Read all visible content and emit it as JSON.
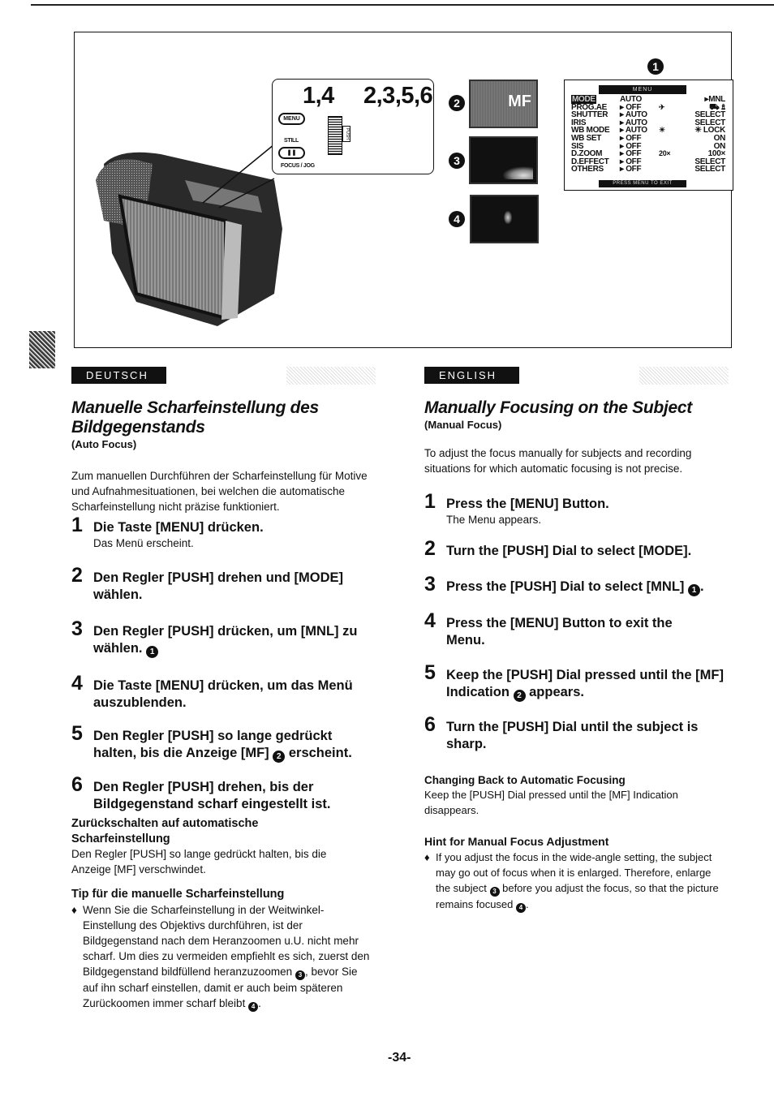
{
  "figure": {
    "callout": {
      "group_a": "1,4",
      "group_b": "2,3,5,6",
      "menu_button": "MENU",
      "still_label": "STILL",
      "still_button": "❚❚",
      "focus_jog_label": "FOCUS / JOG",
      "push_label": "PUSH"
    },
    "badges": [
      "1",
      "2",
      "3",
      "4"
    ],
    "screen_2_indicator": "MF",
    "menu_display": {
      "header": "MENU",
      "rows": [
        {
          "item": "MODE",
          "current": "AUTO",
          "extra": "",
          "option": "▸MNL",
          "highlight": true
        },
        {
          "item": "PROG.AE",
          "current": "▸ OFF",
          "extra": "✈",
          "option": "⛟ ♙",
          "highlight": false
        },
        {
          "item": "SHUTTER",
          "current": "▸ AUTO",
          "extra": "",
          "option": "SELECT",
          "highlight": false
        },
        {
          "item": "IRIS",
          "current": "▸ AUTO",
          "extra": "",
          "option": "SELECT",
          "highlight": false
        },
        {
          "item": "WB MODE",
          "current": "▸ AUTO",
          "extra": "☀",
          "option": "✳ LOCK",
          "highlight": false
        },
        {
          "item": "WB SET",
          "current": "▸ OFF",
          "extra": "",
          "option": "ON",
          "highlight": false
        },
        {
          "item": "SIS",
          "current": "▸ OFF",
          "extra": "",
          "option": "ON",
          "highlight": false
        },
        {
          "item": "D.ZOOM",
          "current": "▸ OFF",
          "extra": "20×",
          "option": "100×",
          "highlight": false
        },
        {
          "item": "D.EFFECT",
          "current": "▸ OFF",
          "extra": "",
          "option": "SELECT",
          "highlight": false
        },
        {
          "item": "OTHERS",
          "current": "▸ OFF",
          "extra": "",
          "option": "SELECT",
          "highlight": false
        }
      ],
      "footer": "PRESS MENU TO EXIT"
    }
  },
  "deutsch": {
    "lang_tab": "DEUTSCH",
    "title": "Manuelle Scharfeinstellung des Bildgegenstands",
    "subtitle": "(Auto Focus)",
    "intro": "Zum manuellen Durchführen der Scharfeinstellung für Motive und Aufnahmesituationen, bei welchen die automatische Scharfeinstellung nicht präzise funktioniert.",
    "steps": [
      {
        "num": "1",
        "text": "Die Taste [MENU] drücken.",
        "note": "Das Menü erscheint."
      },
      {
        "num": "2",
        "text": "Den Regler [PUSH] drehen und [MODE] wählen."
      },
      {
        "num": "3",
        "text": "Den Regler [PUSH] drücken, um [MNL] zu wählen.",
        "badge": "1"
      },
      {
        "num": "4",
        "text": "Die Taste [MENU] drücken, um das Menü auszublenden."
      },
      {
        "num": "5",
        "text": "Den Regler [PUSH] so lange gedrückt halten, bis die Anzeige [MF]",
        "badge": "2",
        "tail": "erscheint."
      },
      {
        "num": "6",
        "text": "Den Regler [PUSH] drehen, bis der Bildgegenstand scharf eingestellt ist."
      }
    ],
    "revert_heading": "Zurückschalten auf automatische Scharfeinstellung",
    "revert_text": "Den Regler [PUSH] so lange gedrückt halten, bis die Anzeige [MF] verschwindet.",
    "tip_heading": "Tip für die manuelle Scharfeinstellung",
    "tip_text_a": "Wenn Sie die Scharfeinstellung in der Weitwinkel-Einstellung des Objektivs durchführen, ist der Bildgegenstand nach dem Heranzoomen u.U. nicht mehr scharf. Um dies zu vermeiden empfiehlt es sich, zuerst den Bildgegenstand bildfüllend heranzuzoomen",
    "tip_badge_a": "3",
    "tip_text_b": ", bevor Sie auf ihn scharf einstellen, damit er auch beim späteren Zurückoomen immer scharf bleibt",
    "tip_badge_b": "4",
    "tip_text_c": "."
  },
  "english": {
    "lang_tab": "ENGLISH",
    "title": "Manually Focusing on the Subject",
    "subtitle": "(Manual Focus)",
    "intro": "To adjust the focus manually for subjects and recording situations for which automatic focusing is not precise.",
    "steps": [
      {
        "num": "1",
        "text": "Press the [MENU] Button.",
        "note": "The Menu appears."
      },
      {
        "num": "2",
        "text": "Turn the [PUSH] Dial to select [MODE]."
      },
      {
        "num": "3",
        "text": "Press the [PUSH] Dial to select [MNL]",
        "badge": "1",
        "tail": "."
      },
      {
        "num": "4",
        "text": "Press the [MENU] Button to exit the Menu."
      },
      {
        "num": "5",
        "text": "Keep the [PUSH] Dial pressed until the [MF] Indication",
        "badge": "2",
        "tail": "appears."
      },
      {
        "num": "6",
        "text": "Turn the [PUSH] Dial until the subject is sharp."
      }
    ],
    "revert_heading": "Changing Back to Automatic Focusing",
    "revert_text": "Keep the [PUSH] Dial pressed until the [MF] Indication disappears.",
    "tip_heading": "Hint for Manual Focus Adjustment",
    "tip_text_a": "If you adjust the focus in the wide-angle setting, the subject may go out of focus when it is enlarged. Therefore, enlarge the subject",
    "tip_badge_a": "3",
    "tip_text_b": " before you adjust the focus, so that the picture remains focused",
    "tip_badge_b": "4",
    "tip_text_c": "."
  },
  "page_number": "-34-"
}
